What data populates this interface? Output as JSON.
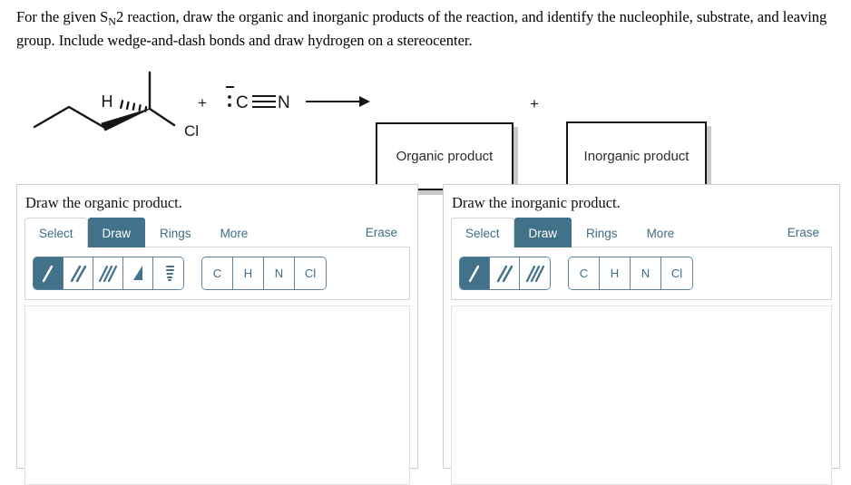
{
  "question": {
    "line1_a": "For the given S",
    "line1_sub": "N",
    "line1_b": "2 reaction, draw the organic and inorganic products of the reaction, and identify the nucleophile, substrate,",
    "line2": "and leaving group. Include wedge-and-dash bonds and draw hydrogen on a stereocenter."
  },
  "reaction": {
    "substrate": {
      "hydrogen_label": "H",
      "chlorine_label": "Cl",
      "description": "2-chlorobutane-like skeletal structure with hashed H and bold wedge bond at the stereocenter"
    },
    "plus_1": "+",
    "plus_2": "+",
    "nucleophile": {
      "carbon_label": "C",
      "nitrogen_label": "N",
      "charge": "−",
      "name": "cyanide-ion"
    },
    "arrow_name": "reaction-arrow",
    "organic_product_label": "Organic product",
    "inorganic_product_label": "Inorganic product"
  },
  "colors": {
    "accent_teal": "#42718a",
    "accent_text": "#3d6d88",
    "panel_border": "#cfcfcf",
    "box_shadow": "#c9c9c9",
    "structure_black": "#161616"
  },
  "panels": [
    {
      "id": "organic",
      "title": "Draw the organic product.",
      "tabs": [
        {
          "label": "Select",
          "active": false
        },
        {
          "label": "Draw",
          "active": true
        },
        {
          "label": "Rings",
          "active": false
        },
        {
          "label": "More",
          "active": false
        }
      ],
      "erase_label": "Erase",
      "bond_tools": [
        {
          "name": "single-bond",
          "selected": true
        },
        {
          "name": "double-bond",
          "selected": false
        },
        {
          "name": "triple-bond",
          "selected": false
        },
        {
          "name": "wedge-bond",
          "selected": false
        },
        {
          "name": "hash-bond",
          "selected": false
        }
      ],
      "elements": [
        "C",
        "H",
        "N",
        "Cl"
      ]
    },
    {
      "id": "inorganic",
      "title": "Draw the inorganic product.",
      "tabs": [
        {
          "label": "Select",
          "active": false
        },
        {
          "label": "Draw",
          "active": true
        },
        {
          "label": "Rings",
          "active": false
        },
        {
          "label": "More",
          "active": false
        }
      ],
      "erase_label": "Erase",
      "bond_tools": [
        {
          "name": "single-bond",
          "selected": true
        },
        {
          "name": "double-bond",
          "selected": false
        },
        {
          "name": "triple-bond",
          "selected": false
        }
      ],
      "elements": [
        "C",
        "H",
        "N",
        "Cl"
      ]
    }
  ]
}
